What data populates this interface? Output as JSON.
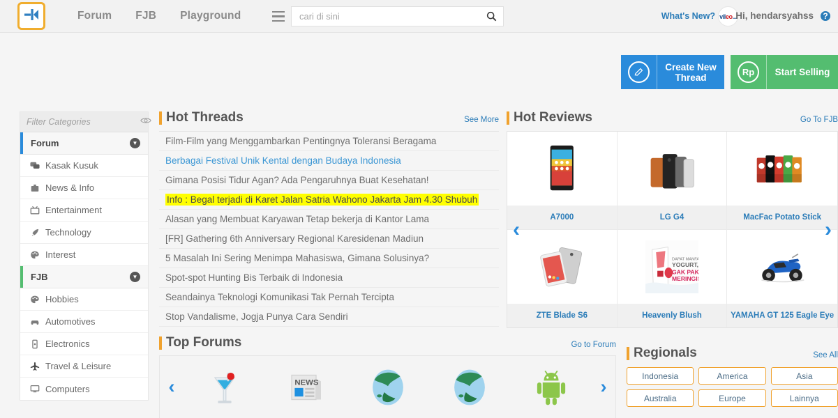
{
  "colors": {
    "brand_orange": "#f0a22e",
    "brand_blue": "#2a8bdb",
    "brand_green": "#54bd70",
    "link_blue": "#2b7cb8",
    "highlight_yellow": "#ffff00"
  },
  "header": {
    "logo_label": "K",
    "nav": [
      {
        "label": "Forum",
        "name": "nav-forum"
      },
      {
        "label": "FJB",
        "name": "nav-fjb"
      },
      {
        "label": "Playground",
        "name": "nav-playground"
      }
    ],
    "search": {
      "value": "",
      "placeholder": "cari di sini",
      "icon": "search-icon"
    },
    "menu_icon": "hamburger-menu-icon",
    "whats_new": "What's New?",
    "avatar_text_1": "vil",
    "avatar_text_2": "eo",
    "avatar_text_3": "...",
    "greeting": "Hi, hendarsyahss",
    "help_icon_label": "?"
  },
  "actions": {
    "create_thread": {
      "label": "Create New Thread",
      "icon": "pencil-icon",
      "icon_glyph": "✎"
    },
    "start_selling": {
      "label": "Start Selling",
      "icon": "rupiah-icon",
      "icon_glyph": "Rp"
    }
  },
  "sidebar": {
    "filter_placeholder": "Filter Categories",
    "filter_value": "",
    "eye_icon": "eye-icon",
    "groups": [
      {
        "title": "Forum",
        "accent": "#2a8bdb",
        "items": [
          {
            "label": "Kasak Kusuk",
            "icon": "chat-bubbles-icon"
          },
          {
            "label": "News & Info",
            "icon": "briefcase-icon"
          },
          {
            "label": "Entertainment",
            "icon": "tv-icon"
          },
          {
            "label": "Technology",
            "icon": "rocket-icon"
          },
          {
            "label": "Interest",
            "icon": "palette-icon"
          }
        ]
      },
      {
        "title": "FJB",
        "accent": "#54bd70",
        "items": [
          {
            "label": "Hobbies",
            "icon": "palette-icon"
          },
          {
            "label": "Automotives",
            "icon": "car-icon"
          },
          {
            "label": "Electronics",
            "icon": "phone-icon"
          },
          {
            "label": "Travel & Leisure",
            "icon": "airplane-icon"
          },
          {
            "label": "Computers",
            "icon": "monitor-icon"
          }
        ]
      }
    ]
  },
  "hot_threads": {
    "title": "Hot Threads",
    "see_more": "See More",
    "items": [
      {
        "text": "Film-Film yang Menggambarkan Pentingnya Toleransi Beragama",
        "style": "normal"
      },
      {
        "text": "Berbagai Festival Unik Kental dengan Budaya Indonesia",
        "style": "link"
      },
      {
        "text": "Gimana Posisi Tidur Agan? Ada Pengaruhnya Buat Kesehatan!",
        "style": "normal"
      },
      {
        "text": "Info : Begal terjadi di Karet Jalan Satria Wahono Jakarta Jam 4.30 Shubuh",
        "style": "highlight"
      },
      {
        "text": "Alasan yang Membuat Karyawan Tetap bekerja di Kantor Lama",
        "style": "normal"
      },
      {
        "text": "[FR] Gathering 6th Anniversary Regional Karesidenan Madiun",
        "style": "normal"
      },
      {
        "text": "5 Masalah Ini Sering Menimpa Mahasiswa, Gimana Solusinya?",
        "style": "normal"
      },
      {
        "text": "Spot-spot Hunting Bis Terbaik di Indonesia",
        "style": "normal"
      },
      {
        "text": "Seandainya Teknologi Komunikasi Tak Pernah Tercipta",
        "style": "normal"
      },
      {
        "text": "Stop Vandalisme, Jogja Punya Cara Sendiri",
        "style": "normal"
      }
    ]
  },
  "hot_reviews": {
    "title": "Hot Reviews",
    "link": "Go To FJB",
    "prev_icon": "chevron-left-icon",
    "next_icon": "chevron-right-icon",
    "items": [
      {
        "name": "A7000",
        "image": "smartphone-lenovo-thumbnail"
      },
      {
        "name": "LG G4",
        "image": "smartphone-lg-g4-thumbnail"
      },
      {
        "name": "MacFac Potato Stick",
        "image": "snack-packets-thumbnail"
      },
      {
        "name": "ZTE Blade S6",
        "image": "smartphone-zte-thumbnail"
      },
      {
        "name": "Heavenly Blush",
        "image": "yogurt-carton-thumbnail"
      },
      {
        "name": "YAMAHA GT 125 Eagle Eye",
        "image": "motorcycle-thumbnail"
      }
    ]
  },
  "top_forums": {
    "title": "Top Forums",
    "link": "Go to Forum",
    "prev_icon": "chevron-left-icon",
    "next_icon": "chevron-right-icon",
    "items": [
      {
        "icon": "cocktail-glass-icon"
      },
      {
        "icon": "newspaper-icon"
      },
      {
        "icon": "globe-icon"
      },
      {
        "icon": "globe-icon"
      },
      {
        "icon": "android-robot-icon"
      }
    ]
  },
  "regionals": {
    "title": "Regionals",
    "link": "See All",
    "items": [
      "Indonesia",
      "America",
      "Asia",
      "Australia",
      "Europe",
      "Lainnya"
    ]
  }
}
